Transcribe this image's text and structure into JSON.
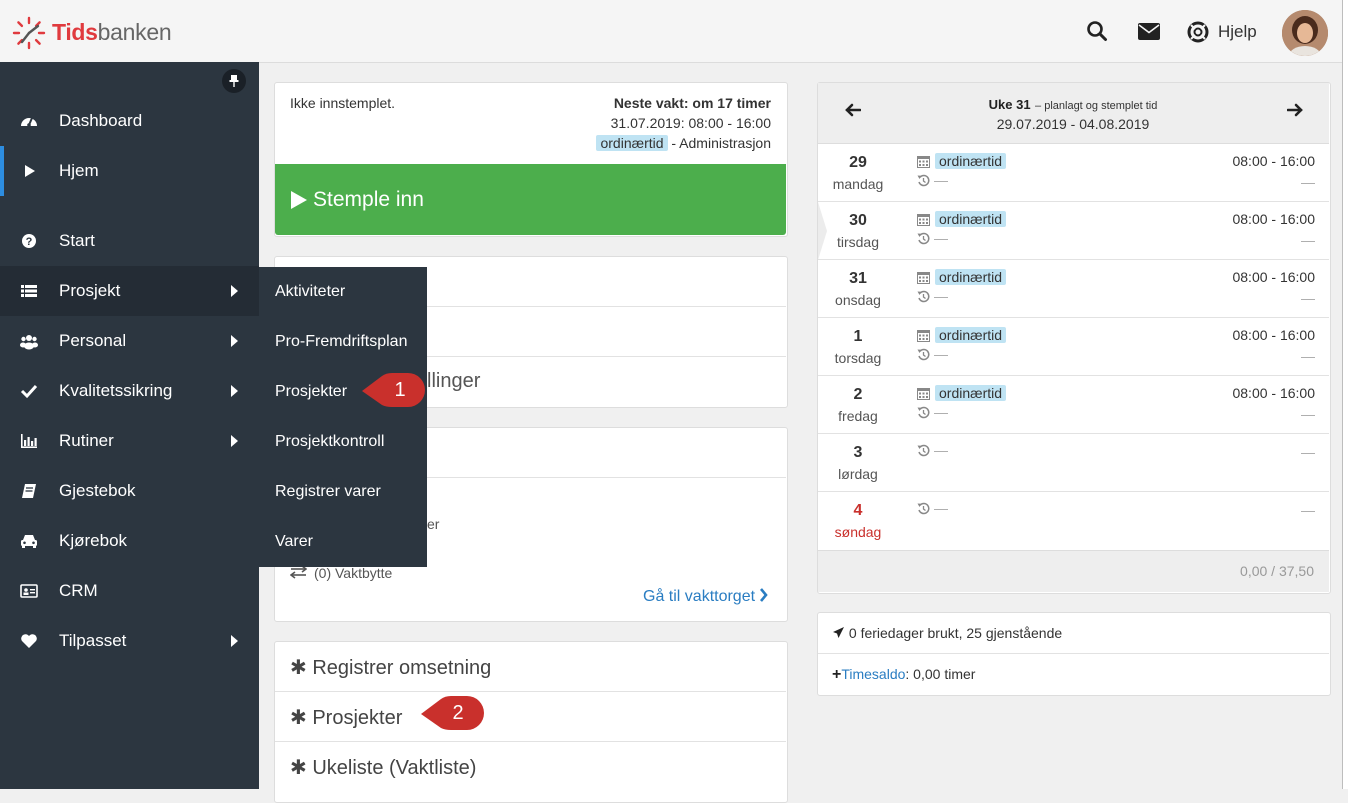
{
  "brand": {
    "bold": "Tids",
    "normal": "banken"
  },
  "header": {
    "help_label": "Hjelp"
  },
  "sidebar": {
    "items": [
      {
        "label": "Dashboard",
        "icon": "dashboard-icon"
      },
      {
        "label": "Hjem",
        "icon": "play-icon"
      },
      {
        "label": "Start",
        "icon": "question-circle-icon"
      },
      {
        "label": "Prosjekt",
        "icon": "list-icon"
      },
      {
        "label": "Personal",
        "icon": "users-icon"
      },
      {
        "label": "Kvalitetssikring",
        "icon": "check-icon"
      },
      {
        "label": "Rutiner",
        "icon": "bar-chart-icon"
      },
      {
        "label": "Gjestebok",
        "icon": "book-icon"
      },
      {
        "label": "Kjørebok",
        "icon": "car-icon"
      },
      {
        "label": "CRM",
        "icon": "contact-card-icon"
      },
      {
        "label": "Tilpasset",
        "icon": "heart-icon"
      }
    ]
  },
  "submenu": {
    "items": [
      "Aktiviteter",
      "Pro-Fremdriftsplan",
      "Prosjekter",
      "Prosjektkontroll",
      "Registrer varer",
      "Varer"
    ]
  },
  "callouts": [
    "1",
    "2"
  ],
  "stamp": {
    "status": "Ikke innstemplet.",
    "next_shift": "Neste vakt: om 17 timer",
    "shift_time": "31.07.2019: 08:00 - 16:00",
    "tag": "ordinærtid",
    "department": "- Administrasjon",
    "button": "Stemple inn"
  },
  "middle": {
    "partial_text_1": "llinger",
    "partial_text_2": "er",
    "vaktbytte": "(0) Vaktbytte",
    "vakttorget_link": "Gå til vakttorget",
    "shortcuts": [
      "Registrer omsetning",
      "Prosjekter",
      "Ukeliste (Vaktliste)"
    ]
  },
  "week": {
    "title": "Uke 31",
    "subtitle": "– planlagt og stemplet tid",
    "range": "29.07.2019 - 04.08.2019",
    "days": [
      {
        "num": "29",
        "name": "mandag",
        "tag": "ordinærtid",
        "time": "08:00 - 16:00",
        "stamp": "—",
        "right": "—"
      },
      {
        "num": "30",
        "name": "tirsdag",
        "tag": "ordinærtid",
        "time": "08:00 - 16:00",
        "stamp": "—",
        "right": "—"
      },
      {
        "num": "31",
        "name": "onsdag",
        "tag": "ordinærtid",
        "time": "08:00 - 16:00",
        "stamp": "—",
        "right": "—"
      },
      {
        "num": "1",
        "name": "torsdag",
        "tag": "ordinærtid",
        "time": "08:00 - 16:00",
        "stamp": "—",
        "right": "—"
      },
      {
        "num": "2",
        "name": "fredag",
        "tag": "ordinærtid",
        "time": "08:00 - 16:00",
        "stamp": "—",
        "right": "—"
      },
      {
        "num": "3",
        "name": "lørdag",
        "tag": "",
        "time": "",
        "stamp": "—",
        "right": "—"
      },
      {
        "num": "4",
        "name": "søndag",
        "tag": "",
        "time": "",
        "stamp": "—",
        "right": "—"
      }
    ],
    "total": "0,00 / 37,50"
  },
  "vacation": "0 feriedager brukt, 25 gjenstående",
  "timesaldo": {
    "label": "Timesaldo",
    "value": ": 0,00 timer"
  },
  "colors": {
    "accent": "#2d8de0",
    "sidebar": "#2c3640",
    "green": "#4cae4c",
    "callout": "#c9302c",
    "brand": "#e03a3e",
    "sunday": "#c9302c"
  }
}
